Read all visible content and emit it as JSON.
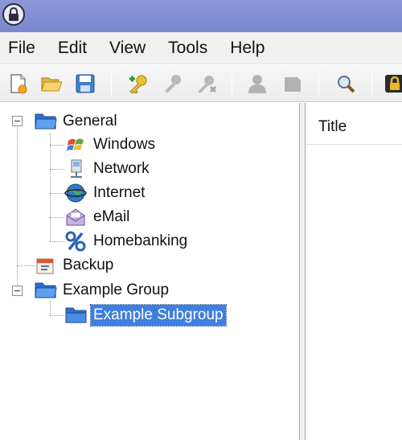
{
  "menu": [
    {
      "label": "File"
    },
    {
      "label": "Edit"
    },
    {
      "label": "View"
    },
    {
      "label": "Tools"
    },
    {
      "label": "Help"
    }
  ],
  "toolbar": {
    "buttons": [
      {
        "icon": "new-database-icon",
        "enabled": true
      },
      {
        "icon": "open-database-icon",
        "enabled": true
      },
      {
        "icon": "save-database-icon",
        "enabled": true
      },
      {
        "icon": "add-entry-icon",
        "enabled": true
      },
      {
        "icon": "edit-entry-icon",
        "enabled": false
      },
      {
        "icon": "delete-entry-icon",
        "enabled": false
      },
      {
        "icon": "copy-username-icon",
        "enabled": false
      },
      {
        "icon": "copy-password-icon",
        "enabled": false
      },
      {
        "icon": "find-icon",
        "enabled": true
      },
      {
        "icon": "lock-workspace-icon",
        "enabled": true
      }
    ]
  },
  "tree": {
    "groups": [
      {
        "label": "General",
        "icon": "folder-open-icon",
        "expanded": true,
        "children": [
          {
            "label": "Windows",
            "icon": "windows-icon"
          },
          {
            "label": "Network",
            "icon": "network-icon"
          },
          {
            "label": "Internet",
            "icon": "internet-icon"
          },
          {
            "label": "eMail",
            "icon": "email-icon"
          },
          {
            "label": "Homebanking",
            "icon": "percent-icon"
          }
        ]
      },
      {
        "label": "Backup",
        "icon": "backup-icon"
      },
      {
        "label": "Example Group",
        "icon": "folder-open-icon",
        "expanded": true,
        "children": [
          {
            "label": "Example Subgroup",
            "icon": "folder-icon",
            "selected": true
          }
        ]
      }
    ]
  },
  "list": {
    "columns": [
      {
        "label": "Title"
      }
    ]
  },
  "colors": {
    "titlebar": "#8b99d8",
    "selection": "#3d80df",
    "folder": "#2f6fd0"
  }
}
